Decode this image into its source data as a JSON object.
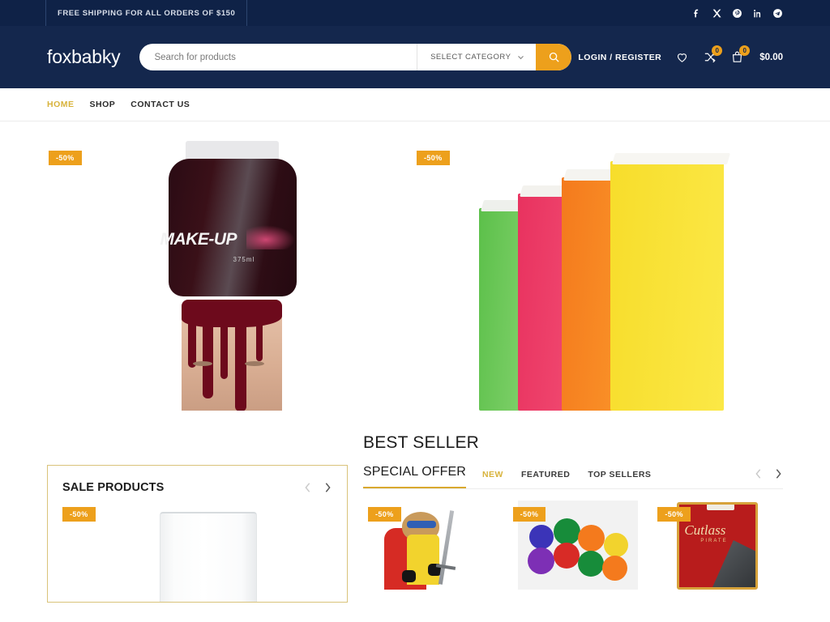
{
  "topbar": {
    "message": "FREE SHIPPING FOR ALL ORDERS OF $150",
    "socials": [
      {
        "name": "facebook-icon",
        "label": "f"
      },
      {
        "name": "x-twitter-icon",
        "label": "X"
      },
      {
        "name": "pinterest-icon",
        "label": "P"
      },
      {
        "name": "linkedin-icon",
        "label": "in"
      },
      {
        "name": "telegram-icon",
        "label": "T"
      }
    ]
  },
  "header": {
    "logo": "foxbabky",
    "search": {
      "placeholder": "Search for products",
      "value": "",
      "category_label": "SELECT CATEGORY"
    },
    "login_label": "LOGIN / REGISTER",
    "wishlist_count": "",
    "compare_count": "0",
    "cart_count": "0",
    "cart_total": "$0.00"
  },
  "nav": {
    "items": [
      {
        "label": "HOME",
        "active": true
      },
      {
        "label": "SHOP",
        "active": false
      },
      {
        "label": "CONTACT US",
        "active": false
      }
    ]
  },
  "banners": [
    {
      "name": "makeup-blood-bottle-banner",
      "badge": "-50%",
      "product_text": "MAKE-UP",
      "product_sub": "375ml"
    },
    {
      "name": "paper-bags-banner",
      "badge": "-50%"
    }
  ],
  "bestseller": {
    "title": "BEST SELLER"
  },
  "sale_products": {
    "title": "SALE PRODUCTS",
    "prev_label": "‹",
    "next_label": "›",
    "items": [
      {
        "name": "drinking-glass-product",
        "badge": "-50%"
      }
    ]
  },
  "special_offer": {
    "title": "SPECIAL OFFER",
    "tabs": [
      {
        "label": "NEW",
        "active": true
      },
      {
        "label": "FEATURED",
        "active": false
      },
      {
        "label": "TOP SELLERS",
        "active": false
      }
    ],
    "prev_label": "‹",
    "next_label": "›",
    "items": [
      {
        "name": "superhero-costume-product",
        "badge": "-50%"
      },
      {
        "name": "smiley-balls-product",
        "badge": "-50%"
      },
      {
        "name": "cutlass-sword-product",
        "badge": "-50%",
        "pack_title": "Cutlass",
        "pack_sub": "PIRATE"
      }
    ]
  },
  "colors": {
    "topbar_navy": "#0f2247",
    "header_navy": "#14274d",
    "accent_amber": "#eda01c",
    "accent_gold": "#d8b33c",
    "panel_border_gold": "#d9c37a"
  }
}
